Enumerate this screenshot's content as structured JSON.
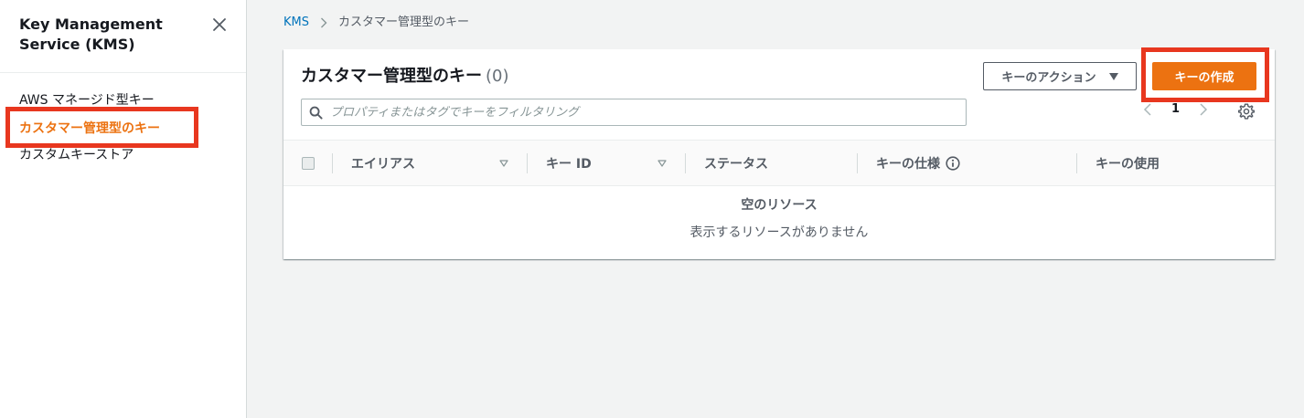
{
  "sidebar": {
    "title": "Key Management Service (KMS)",
    "items": [
      {
        "label": "AWS マネージド型キー",
        "active": false
      },
      {
        "label": "カスタマー管理型のキー",
        "active": true
      },
      {
        "label": "カスタムキーストア",
        "active": false
      }
    ]
  },
  "breadcrumb": {
    "root": "KMS",
    "current": "カスタマー管理型のキー"
  },
  "panel": {
    "title": "カスタマー管理型のキー",
    "count": "(0)",
    "actions_button": "キーのアクション",
    "create_button": "キーの作成",
    "search_placeholder": "プロパティまたはタグでキーをフィルタリング",
    "page_number": "1"
  },
  "table": {
    "columns": [
      "エイリアス",
      "キー ID",
      "ステータス",
      "キーの仕様",
      "キーの使用"
    ],
    "rows": [],
    "empty_title": "空のリソース",
    "empty_desc": "表示するリソースがありません"
  },
  "colors": {
    "accent": "#ec7211",
    "link": "#0073bb",
    "highlight": "#e8371f"
  }
}
